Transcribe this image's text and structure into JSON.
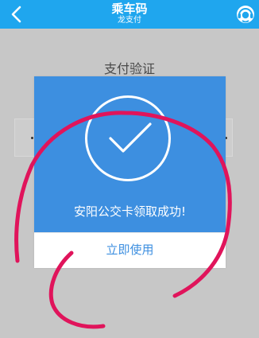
{
  "header": {
    "title": "乘车码",
    "subtitle": "龙支付",
    "back_icon": "chevron-left-icon",
    "service_icon": "customer-service-icon",
    "background_color": "#1fa6ee"
  },
  "underlay": {
    "title": "支付验证"
  },
  "dialog": {
    "icon": "check-circle-icon",
    "message": "安阳公交卡领取成功!",
    "button_label": "立即使用",
    "background_color": "#3d8fe0"
  },
  "overlay": {
    "scribble_color": "#e0145b"
  }
}
